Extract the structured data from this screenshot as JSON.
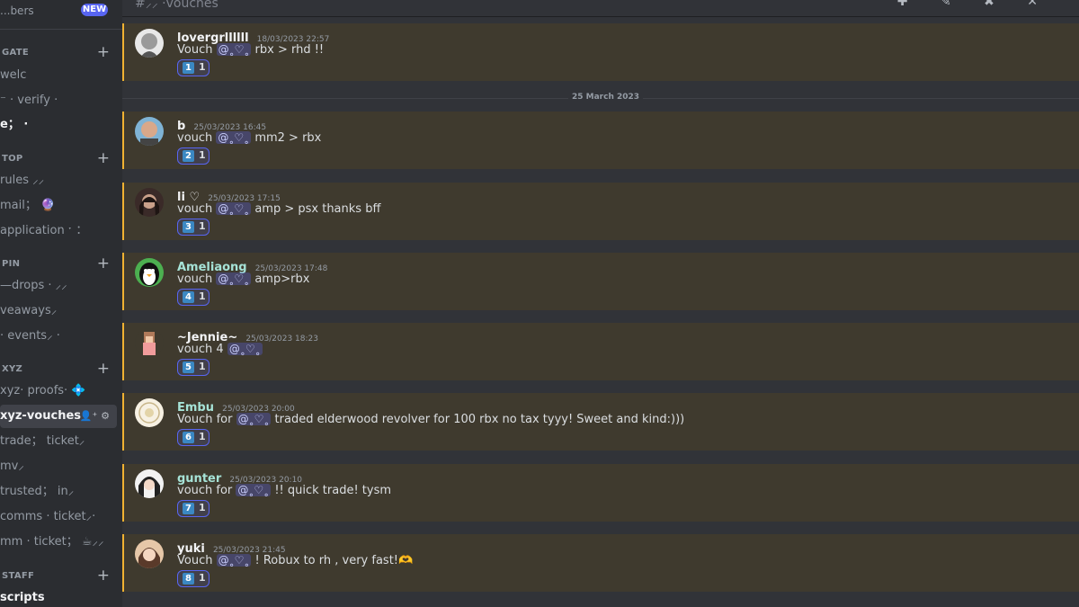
{
  "sidebar": {
    "top_item": "...bers",
    "top_badge": "NEW",
    "categories": [
      {
        "name": "GATE"
      },
      {
        "name": "TOP"
      },
      {
        "name": "PIN"
      },
      {
        "name": "XYZ"
      },
      {
        "name": "STAFF"
      }
    ],
    "channels": [
      {
        "label": "welc"
      },
      {
        "label": "⁻ · verify ·"
      },
      {
        "label": "e； ·"
      },
      {
        "label": "rules ⸝⸝"
      },
      {
        "label": "mail； 🔮"
      },
      {
        "label": "application ˑ ："
      },
      {
        "label": "—drops · ⸝⸝"
      },
      {
        "label": "veaways⸝"
      },
      {
        "label": "· events⸝ ·"
      },
      {
        "label": "xyz· proofs· 💠"
      },
      {
        "label": "xyz-vouches"
      },
      {
        "label": "trade； ticket⸝"
      },
      {
        "label": "mv⸝"
      },
      {
        "label": "trusted； in⸝"
      },
      {
        "label": "comms · ticket⸝·"
      },
      {
        "label": "mm · ticket； ☕⸝⸝"
      },
      {
        "label": "scripts"
      }
    ],
    "active_channel_icons": "👤⁺ ⚙"
  },
  "header": {
    "hash_text": "#⸝⸝ ·vouches",
    "icons": "✚ ✎ ✖ ✕"
  },
  "date_divider": "25 March 2023",
  "messages": [
    {
      "author": "lovergrllllll",
      "timestamp": "18/03/2023 22:57",
      "prefix": "Vouch",
      "mention": "@˳♡˳",
      "text": "rbx > rhd !!",
      "reaction_number": "1",
      "reaction_count": "1",
      "author_color": "#f2f3f5"
    },
    {
      "author": "b",
      "timestamp": "25/03/2023 16:45",
      "prefix": "vouch",
      "mention": "@˳♡˳",
      "text": "mm2 > rbx",
      "reaction_number": "2",
      "reaction_count": "1",
      "author_color": "#f2f3f5"
    },
    {
      "author": "li ♡",
      "timestamp": "25/03/2023 17:15",
      "prefix": "vouch",
      "mention": "@˳♡˳",
      "text": "amp > psx thanks bff",
      "reaction_number": "3",
      "reaction_count": "1",
      "author_color": "#f2f3f5"
    },
    {
      "author": "Ameliaong",
      "timestamp": "25/03/2023 17:48",
      "prefix": "vouch",
      "mention": "@˳♡˳",
      "text": "amp>rbx",
      "reaction_number": "4",
      "reaction_count": "1",
      "author_color": "#a6e3d7"
    },
    {
      "author": "~Jennie~",
      "timestamp": "25/03/2023 18:23",
      "prefix": "vouch 4",
      "mention": "@˳♡˳",
      "text": "",
      "reaction_number": "5",
      "reaction_count": "1",
      "author_color": "#f2f3f5"
    },
    {
      "author": "Embu",
      "timestamp": "25/03/2023 20:00",
      "prefix": "Vouch for",
      "mention": "@˳♡˳",
      "text": "traded elderwood revolver for 100 rbx no tax tyyy! Sweet and kind:)))",
      "reaction_number": "6",
      "reaction_count": "1",
      "author_color": "#a6e3d7"
    },
    {
      "author": "gunter",
      "timestamp": "25/03/2023 20:10",
      "prefix": "vouch for",
      "mention": "@˳♡˳",
      "text": "!! quick trade! tysm",
      "reaction_number": "7",
      "reaction_count": "1",
      "author_color": "#a6e3d7"
    },
    {
      "author": "yuki",
      "timestamp": "25/03/2023 21:45",
      "prefix": "Vouch",
      "mention": "@˳♡˳",
      "text": "! Robux to rh , very fast!🫶",
      "reaction_number": "8",
      "reaction_count": "1",
      "author_color": "#f2f3f5"
    }
  ],
  "colors": {
    "highlight_bg": "#3f3a2e",
    "highlight_border": "#f0b232",
    "mention_bg": "#5865f2",
    "keycap_bg": "#3b88c3"
  }
}
